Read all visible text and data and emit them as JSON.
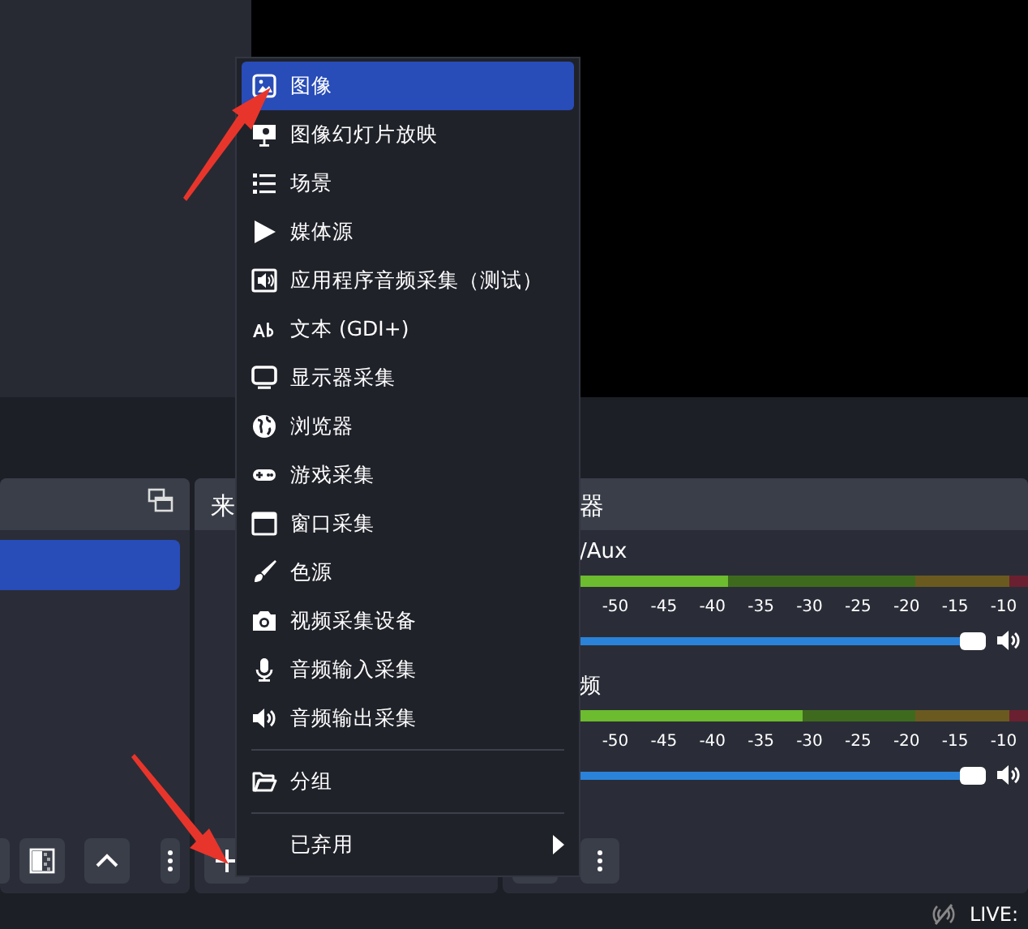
{
  "scenes_dock": {
    "items": [
      {
        "selected": true
      }
    ]
  },
  "sources_dock": {
    "title": "来"
  },
  "mixer": {
    "title": "器",
    "channels": [
      {
        "name": "/Aux",
        "level": 0.36,
        "volume": {
          "level": 1
        },
        "ticks": [
          "-50",
          "-45",
          "-40",
          "-35",
          "-30",
          "-25",
          "-20",
          "-15",
          "-10"
        ]
      },
      {
        "name": "频",
        "level": 0.52,
        "volume": {
          "level": 1
        },
        "ticks": [
          "-50",
          "-45",
          "-40",
          "-35",
          "-30",
          "-25",
          "-20",
          "-15",
          "-10"
        ]
      }
    ]
  },
  "context_menu": {
    "items": [
      {
        "kind": "item",
        "label": "图像",
        "selected": true
      },
      {
        "kind": "item",
        "label": "图像幻灯片放映",
        "selected": false
      },
      {
        "kind": "item",
        "label": "场景",
        "selected": false
      },
      {
        "kind": "item",
        "label": "媒体源",
        "selected": false
      },
      {
        "kind": "item",
        "label": "应用程序音频采集（测试）",
        "selected": false
      },
      {
        "kind": "item",
        "label": "文本 (GDI+)",
        "selected": false
      },
      {
        "kind": "item",
        "label": "显示器采集",
        "selected": false
      },
      {
        "kind": "item",
        "label": "浏览器",
        "selected": false
      },
      {
        "kind": "item",
        "label": "游戏采集",
        "selected": false
      },
      {
        "kind": "item",
        "label": "窗口采集",
        "selected": false
      },
      {
        "kind": "item",
        "label": "色源",
        "selected": false
      },
      {
        "kind": "item",
        "label": "视频采集设备",
        "selected": false
      },
      {
        "kind": "item",
        "label": "音频输入采集",
        "selected": false
      },
      {
        "kind": "item",
        "label": "音频输出采集",
        "selected": false
      },
      {
        "kind": "separator"
      },
      {
        "kind": "item",
        "label": "分组",
        "selected": false
      },
      {
        "kind": "separator"
      },
      {
        "kind": "submenu",
        "label": "已弃用",
        "selected": false
      }
    ]
  },
  "status_bar": {
    "live": "LIVE:"
  }
}
